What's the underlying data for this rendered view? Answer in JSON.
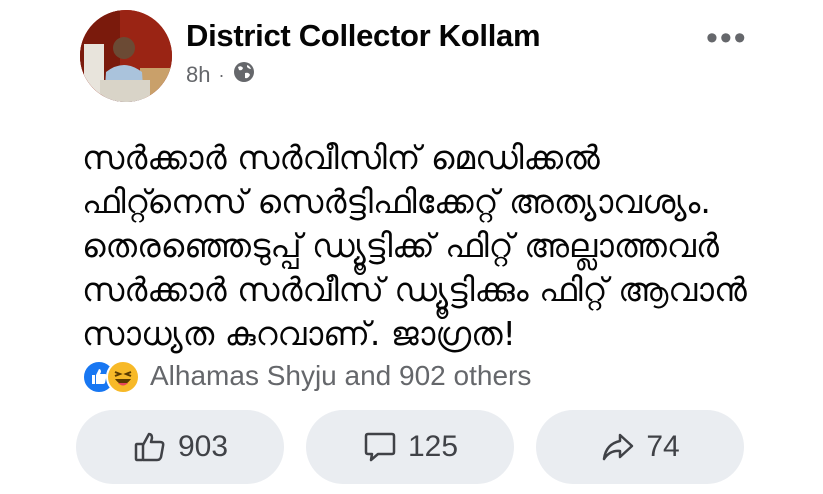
{
  "post": {
    "author": "District Collector Kollam",
    "time": "8h",
    "separator": "·",
    "audience_icon": "globe-icon",
    "more_icon": "more-options-icon",
    "more_label": "•••",
    "text_lines": [
      "സർക്കാർ സർവീസിന് മെഡിക്കൽ",
      "ഫിറ്റ്നെസ് സെർട്ടിഫിക്കേറ്റ് അത്യാവശ്യം.",
      "തെരഞ്ഞെടുപ്പ് ഡ്യൂട്ടിക്ക് ഫിറ്റ് അല്ലാത്തവർ",
      "സർക്കാർ സർവീസ് ഡ്യൂട്ടിക്കും ഫിറ്റ് ആവാൻ",
      "സാധ്യത കുറവാണ്. ജാഗ്രത!"
    ]
  },
  "reactions": {
    "label": "Alhamas Shyju and 902 others",
    "icons": [
      "like-icon",
      "haha-icon"
    ]
  },
  "actions": {
    "like": {
      "count": "903",
      "icon": "like-thumb-icon"
    },
    "comment": {
      "count": "125",
      "icon": "comment-bubble-icon"
    },
    "share": {
      "count": "74",
      "icon": "share-arrow-icon"
    }
  },
  "colors": {
    "accent": "#1877f2",
    "secondary_text": "#65676b",
    "button_bg": "#eaedf1",
    "haha": "#f7b928"
  }
}
